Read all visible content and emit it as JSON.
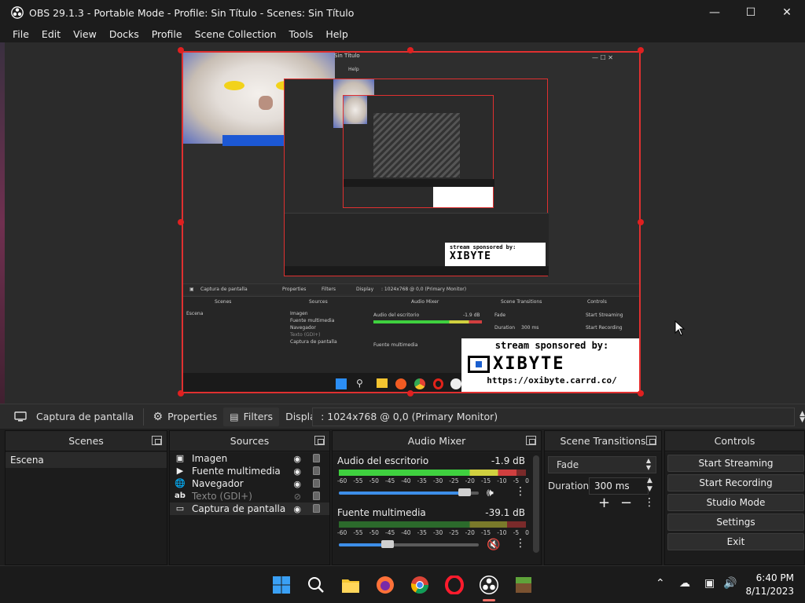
{
  "window": {
    "title": "OBS 29.1.3 - Portable Mode - Profile: Sin Título - Scenes: Sin Título"
  },
  "menu": [
    "File",
    "Edit",
    "View",
    "Docks",
    "Profile",
    "Scene Collection",
    "Tools",
    "Help"
  ],
  "preview": {
    "nested_title": "Sin Título",
    "nested_menu": "Help",
    "sponsor_line1": "stream sponsored by:",
    "sponsor_logo": "XIBYTE",
    "sponsor_url": "https://oxibyte.carrd.co/",
    "mini_source": "Captura de pantalla",
    "mini_props": "Properties",
    "mini_filters": "Filters",
    "mini_display": "Display",
    "mini_display_value": ": 1024x768 @ 0,0 (Primary Monitor)",
    "mini_scenes": "Scenes",
    "mini_sources": "Sources",
    "mini_mixer": "Audio Mixer",
    "mini_transitions": "Scene Transitions",
    "mini_controls": "Controls",
    "mini_scene_item": "Escena",
    "mini_sources_list": [
      "Imagen",
      "Fuente multimedia",
      "Navegador",
      "Texto (GDI+)",
      "Captura de pantalla"
    ],
    "mini_ch1": "Audio del escritorio",
    "mini_ch1_db": "-1.9 dB",
    "mini_ch2": "Fuente multimedia",
    "mini_fade": "Fade",
    "mini_duration": "Duration",
    "mini_duration_val": "300 ms",
    "mini_start_streaming": "Start Streaming",
    "mini_start_recording": "Start Recording"
  },
  "propbar": {
    "source": "Captura de pantalla",
    "properties": "Properties",
    "filters": "Filters",
    "display_label": "Display",
    "display_value": ": 1024x768 @ 0,0 (Primary Monitor)"
  },
  "docks": {
    "scenes": {
      "title": "Scenes",
      "items": [
        "Escena"
      ]
    },
    "sources": {
      "title": "Sources",
      "items": [
        {
          "label": "Imagen",
          "icon": "image-icon"
        },
        {
          "label": "Fuente multimedia",
          "icon": "play-icon"
        },
        {
          "label": "Navegador",
          "icon": "globe-icon"
        },
        {
          "label": "Texto (GDI+)",
          "icon": "text-icon"
        },
        {
          "label": "Captura de pantalla",
          "icon": "monitor-icon"
        }
      ]
    },
    "mixer": {
      "title": "Audio Mixer",
      "channels": [
        {
          "name": "Audio del escritorio",
          "db": "-1.9 dB",
          "volume": 0.9
        },
        {
          "name": "Fuente multimedia",
          "db": "-39.1 dB",
          "volume": 0.35
        }
      ],
      "scale": [
        "-60",
        "-55",
        "-50",
        "-45",
        "-40",
        "-35",
        "-30",
        "-25",
        "-20",
        "-15",
        "-10",
        "-5",
        "0"
      ]
    },
    "transitions": {
      "title": "Scene Transitions",
      "type": "Fade",
      "duration_label": "Duration",
      "duration": "300 ms"
    },
    "controls": {
      "title": "Controls",
      "buttons": [
        "Start Streaming",
        "Start Recording",
        "Studio Mode",
        "Settings",
        "Exit"
      ]
    }
  },
  "taskbar": {
    "time": "6:40 PM",
    "date": "8/11/2023"
  },
  "colors": {
    "accent": "#3d8ee8",
    "selection_red": "#e03030"
  }
}
